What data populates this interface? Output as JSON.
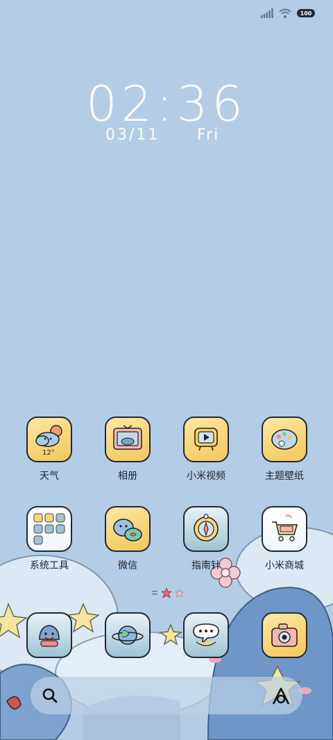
{
  "status_bar": {
    "battery_level": "100",
    "icons": [
      "signal-icon",
      "wifi-icon",
      "battery-icon"
    ]
  },
  "clock": {
    "time": "02:36",
    "date": "03/11",
    "weekday": "Fri"
  },
  "apps": [
    {
      "label": "天气",
      "icon": "weather-icon",
      "temp": "12°"
    },
    {
      "label": "相册",
      "icon": "gallery-icon"
    },
    {
      "label": "小米视频",
      "icon": "video-icon"
    },
    {
      "label": "主题壁纸",
      "icon": "themes-icon"
    },
    {
      "label": "系统工具",
      "icon": "tools-folder-icon"
    },
    {
      "label": "微信",
      "icon": "wechat-icon"
    },
    {
      "label": "指南针",
      "icon": "compass-icon"
    },
    {
      "label": "小米商城",
      "icon": "mi-store-icon"
    }
  ],
  "page_indicator": {
    "pages": 2,
    "current": 1
  },
  "dock": [
    {
      "icon": "phone-shark-icon"
    },
    {
      "icon": "browser-planet-icon"
    },
    {
      "icon": "messages-bubble-icon"
    },
    {
      "icon": "camera-icon"
    }
  ],
  "search": {
    "icon": "search-icon",
    "assistant_icon": "assistant-icon"
  },
  "colors": {
    "background": "#b3cde6",
    "tile_yellow": "#f8d577",
    "outline": "#1f2937",
    "label_text": "#1d2430"
  }
}
